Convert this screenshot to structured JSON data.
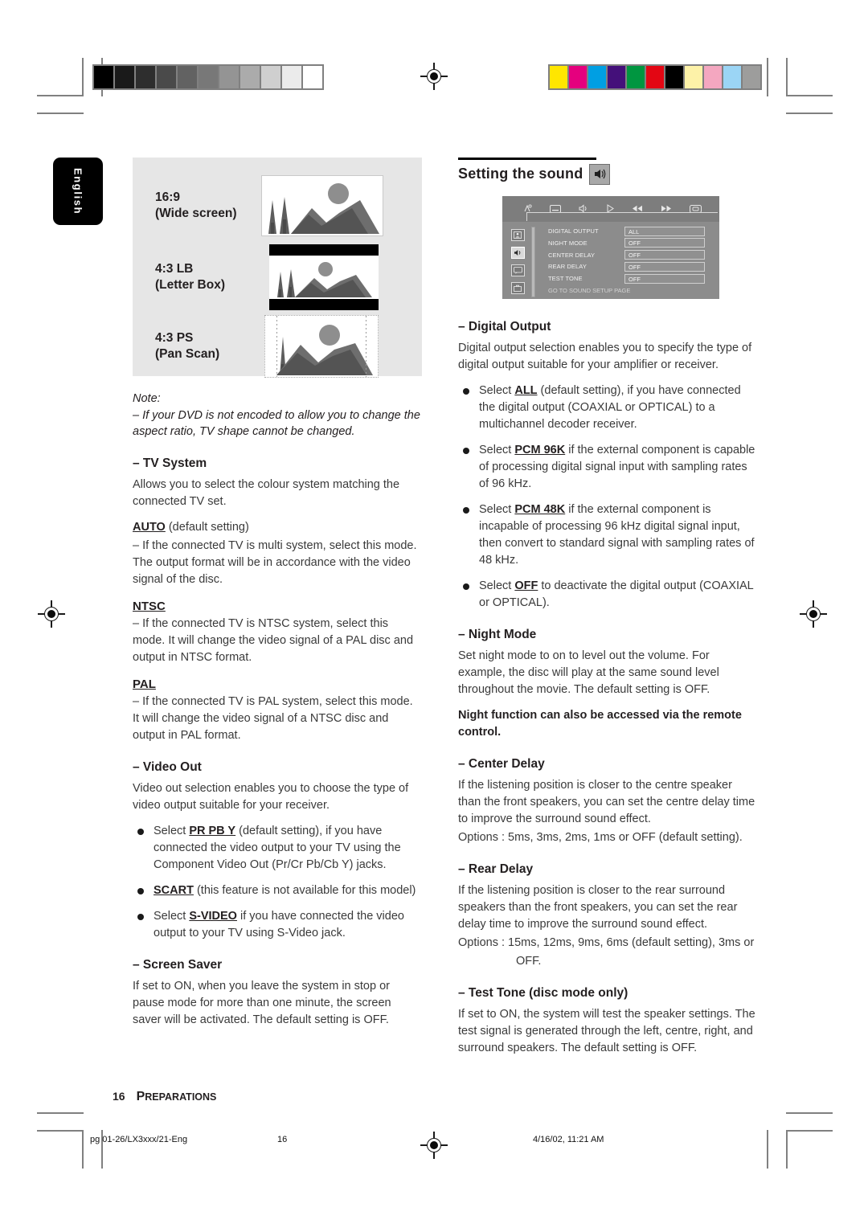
{
  "meta": {
    "language_tab": "English",
    "page_number": "16",
    "section_title": "Preparations"
  },
  "print_marks": {
    "grayscale_steps": [
      "#000000",
      "#1a1a1a",
      "#2e2e2e",
      "#4a4a4a",
      "#626262",
      "#787878",
      "#949494",
      "#ababab",
      "#cfcfcf",
      "#ebebeb",
      "#ffffff"
    ],
    "color_bars": [
      "#ffe600",
      "#e5007e",
      "#009fe3",
      "#44107a",
      "#009640",
      "#e30613",
      "#000000",
      "#fdf2a8",
      "#f4a7c0",
      "#9bd5f5",
      "#9d9d9c"
    ]
  },
  "aspect_panel": {
    "rows": [
      {
        "label_line1": "16:9",
        "label_line2": "(Wide screen)",
        "mode": "wide"
      },
      {
        "label_line1": "4:3 LB",
        "label_line2": "(Letter Box)",
        "mode": "letterbox"
      },
      {
        "label_line1": "4:3 PS",
        "label_line2": "(Pan Scan)",
        "mode": "panscan"
      }
    ]
  },
  "left_column": {
    "note_label": "Note:",
    "note_text": "–  If your DVD is not encoded to allow you to change the aspect ratio, TV shape cannot be changed.",
    "tv_system": {
      "heading": "–  TV System",
      "intro": "Allows you to select the colour system matching the connected TV set.",
      "auto_kw": "AUTO",
      "auto_suffix": " (default setting)",
      "auto_body": "–    If the connected TV is multi system, select this mode. The output format will be in accordance with the video signal of the disc.",
      "ntsc_kw": "NTSC",
      "ntsc_body": "–    If the connected TV is NTSC system, select this mode. It will change the video signal of a PAL disc and output in NTSC format.",
      "pal_kw": "PAL",
      "pal_body": "–    If the connected TV is PAL system, select this mode. It will change the video signal of a NTSC disc and output in PAL format."
    },
    "video_out": {
      "heading": "–  Video Out",
      "intro": "Video out selection enables you to choose the type of video output suitable for your receiver.",
      "bullets": [
        {
          "pre": "Select ",
          "kw": "PR PB Y",
          "post": " (default setting), if you have connected the video output to your TV using the Component Video Out (Pr/Cr Pb/Cb Y) jacks."
        },
        {
          "pre": "",
          "kw": "SCART",
          "post": " (this feature is not available for this model)"
        },
        {
          "pre": "Select ",
          "kw": "S-VIDEO",
          "post": " if you have connected the video output to your TV using S-Video jack."
        }
      ]
    },
    "screen_saver": {
      "heading": "–  Screen Saver",
      "body": "If set to ON, when you leave the system in stop or pause mode for more than one minute, the screen saver will be activated. The default setting is OFF."
    }
  },
  "right_column": {
    "section_heading": "Setting the sound",
    "section_icon": "speaker-icon",
    "osd": {
      "toolbar_icons": [
        "disc-icon",
        "subtitle-icon",
        "audio-icon",
        "play-icon",
        "rewind-icon",
        "forward-icon",
        "repeat-icon"
      ],
      "sidebar_icons": [
        "general-setup-icon",
        "audio-setup-icon",
        "video-setup-icon",
        "preference-setup-icon"
      ],
      "sidebar_selected_index": 1,
      "rows": [
        {
          "key": "DIGITAL OUTPUT",
          "value": "ALL"
        },
        {
          "key": "NIGHT MODE",
          "value": "OFF"
        },
        {
          "key": "CENTER DELAY",
          "value": "OFF"
        },
        {
          "key": "REAR DELAY",
          "value": "OFF"
        },
        {
          "key": "TEST TONE",
          "value": "OFF"
        }
      ],
      "footer": "GO TO SOUND SETUP PAGE"
    },
    "digital_output": {
      "heading": "–  Digital Output",
      "intro": "Digital output selection enables you to specify the type of digital output suitable for your amplifier or receiver.",
      "bullets": [
        {
          "pre": "Select ",
          "kw": "ALL",
          "post": " (default setting), if you have connected the digital output (COAXIAL or OPTICAL) to a multichannel decoder receiver."
        },
        {
          "pre": "Select ",
          "kw": "PCM 96K",
          "post": " if the external component is capable of processing digital signal input with sampling rates of 96 kHz."
        },
        {
          "pre": "Select ",
          "kw": "PCM 48K",
          "post": " if the external component is incapable of processing 96 kHz digital signal input, then convert to standard signal with sampling rates of 48 kHz."
        },
        {
          "pre": "Select ",
          "kw": "OFF",
          "post": " to deactivate the digital output (COAXIAL or OPTICAL)."
        }
      ]
    },
    "night_mode": {
      "heading": "–  Night Mode",
      "body": "Set night mode to on to level out the volume.  For example, the disc will play at the same sound level throughout the movie. The default setting is OFF.",
      "bold_note": "Night function can also be accessed via the remote control."
    },
    "center_delay": {
      "heading": "–  Center Delay",
      "body": "If the listening position is closer to the centre speaker than the front speakers, you can set the centre delay time to improve the surround sound effect.",
      "options": "Options : 5ms, 3ms, 2ms, 1ms or OFF (default setting)."
    },
    "rear_delay": {
      "heading": "–  Rear Delay",
      "body": "If the listening position is closer to the rear surround speakers than the front speakers, you can set the rear delay time to improve the surround sound effect.",
      "options_line1": "Options : 15ms, 12ms, 9ms, 6ms (default setting), 3ms or",
      "options_line2": "OFF."
    },
    "test_tone": {
      "heading": "–  Test Tone  (disc mode only)",
      "body": "If set to ON, the system will test the speaker settings. The test signal is generated through the left, centre, right, and surround speakers. The default setting is OFF."
    }
  },
  "print_footer": {
    "file": "pg 01-26/LX3xxx/21-Eng",
    "page": "16",
    "timestamp": "4/16/02, 11:21 AM"
  }
}
